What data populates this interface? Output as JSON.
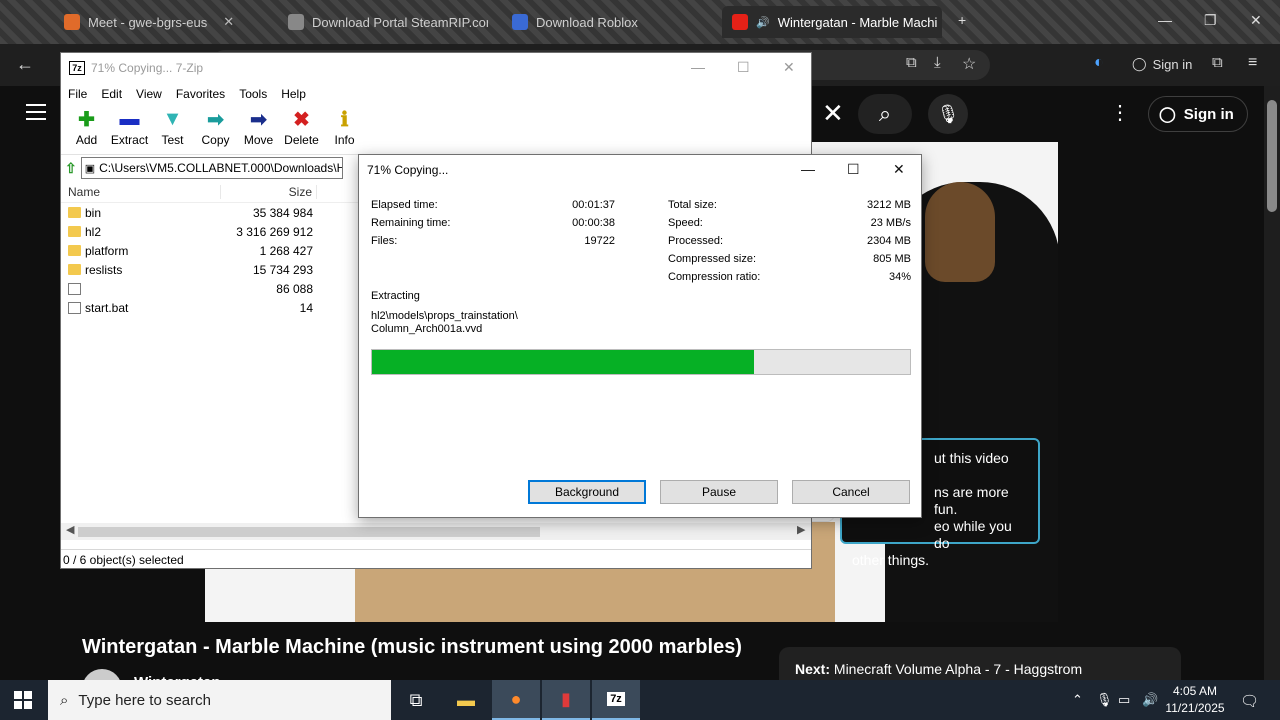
{
  "browser": {
    "tabs": [
      {
        "title": "Meet - gwe-bgrs-eus"
      },
      {
        "title": "Download Portal SteamRIP.com"
      },
      {
        "title": "Download Roblox"
      },
      {
        "title": "Wintergatan - Marble Machi"
      }
    ],
    "signin_label": "Sign in"
  },
  "youtube": {
    "signin_label": "Sign in",
    "tooltip_lines": [
      "ut this video",
      "ns are more fun.",
      "eo while you do",
      "other things."
    ],
    "video_title": "Wintergatan - Marble Machine (music instrument using 2000 marbles)",
    "channel_name": "Wintergatan",
    "next_label": "Next:",
    "next_title": "Minecraft Volume Alpha - 7 - Haggstrom"
  },
  "zip": {
    "window_title": "71% Copying... 7-Zip",
    "logo_text": "7z",
    "menu": [
      "File",
      "Edit",
      "View",
      "Favorites",
      "Tools",
      "Help"
    ],
    "toolbar": [
      {
        "label": "Add",
        "icon": "add-icon",
        "glyph": "✚",
        "color": "#1a9c1a"
      },
      {
        "label": "Extract",
        "icon": "extract-icon",
        "glyph": "▬",
        "color": "#1a2ec4"
      },
      {
        "label": "Test",
        "icon": "test-icon",
        "glyph": "▼",
        "color": "#2fb4b4"
      },
      {
        "label": "Copy",
        "icon": "copy-icon",
        "glyph": "➡",
        "color": "#1a9c9c"
      },
      {
        "label": "Move",
        "icon": "move-icon",
        "glyph": "➡",
        "color": "#1a2e8c"
      },
      {
        "label": "Delete",
        "icon": "delete-icon",
        "glyph": "✖",
        "color": "#d42020"
      },
      {
        "label": "Info",
        "icon": "info-icon",
        "glyph": "ℹ",
        "color": "#c9a100"
      }
    ],
    "address": "C:\\Users\\VM5.COLLABNET.000\\Downloads\\H",
    "columns": {
      "name": "Name",
      "size": "Size"
    },
    "files": [
      {
        "name": "bin",
        "size": "35 384 984",
        "type": "folder"
      },
      {
        "name": "hl2",
        "size": "3 316 269 912",
        "type": "folder"
      },
      {
        "name": "platform",
        "size": "1 268 427",
        "type": "folder"
      },
      {
        "name": "reslists",
        "size": "15 734 293",
        "type": "folder"
      },
      {
        "name": "",
        "size": "86 088",
        "type": "file"
      },
      {
        "name": "start.bat",
        "size": "14",
        "type": "file"
      }
    ],
    "status": "0 / 6 object(s) selected"
  },
  "dialog": {
    "title": "71% Copying...",
    "elapsed_label": "Elapsed time:",
    "elapsed_value": "00:01:37",
    "remaining_label": "Remaining time:",
    "remaining_value": "00:00:38",
    "files_label": "Files:",
    "files_value": "19722",
    "total_label": "Total size:",
    "total_value": "3212 MB",
    "speed_label": "Speed:",
    "speed_value": "23 MB/s",
    "processed_label": "Processed:",
    "processed_value": "2304 MB",
    "compressed_label": "Compressed size:",
    "compressed_value": "805 MB",
    "ratio_label": "Compression ratio:",
    "ratio_value": "34%",
    "extracting_label": "Extracting",
    "path_line1": "hl2\\models\\props_trainstation\\",
    "path_line2": "Column_Arch001a.vvd",
    "progress_fraction": 0.71,
    "progress_color": "#06b025",
    "buttons": {
      "background": "Background",
      "pause": "Pause",
      "cancel": "Cancel"
    }
  },
  "taskbar": {
    "search_placeholder": "Type here to search",
    "time": "4:05 AM",
    "date": "11/21/2025"
  }
}
